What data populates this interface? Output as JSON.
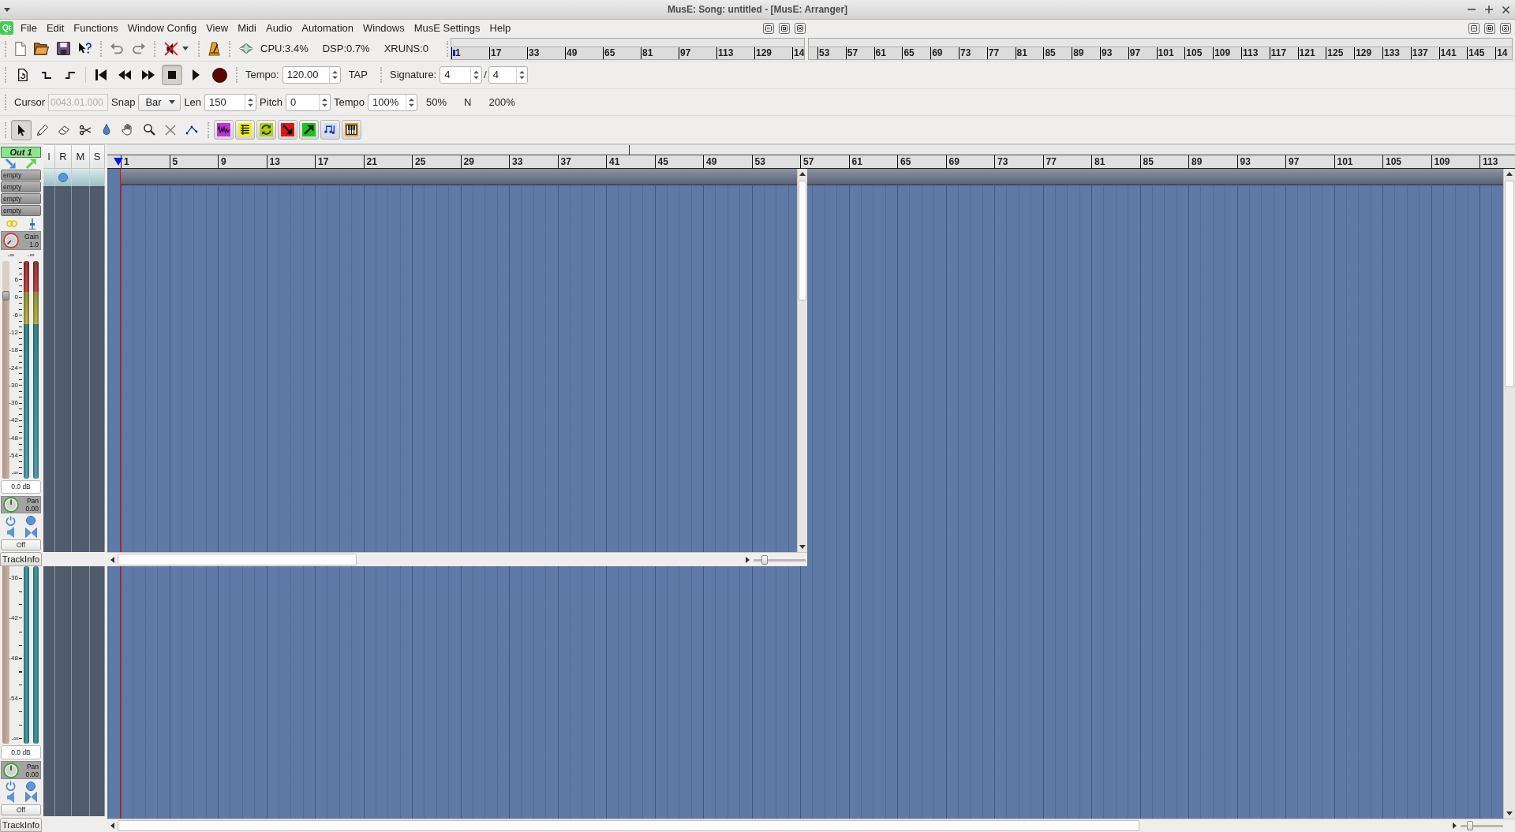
{
  "window": {
    "title": "MusE: Song: untitled - [MusE: Arranger]"
  },
  "app_logo": {
    "label": "Qt"
  },
  "menu": [
    {
      "label": "File"
    },
    {
      "label": "Edit"
    },
    {
      "label": "Functions"
    },
    {
      "label": "Window Config"
    },
    {
      "label": "View"
    },
    {
      "label": "Midi"
    },
    {
      "label": "Audio"
    },
    {
      "label": "Automation"
    },
    {
      "label": "Windows"
    },
    {
      "label": "MusE Settings"
    },
    {
      "label": "Help"
    }
  ],
  "status": {
    "cpu": "CPU:3.4%",
    "dsp": "DSP:0.7%",
    "xruns": "XRUNS:0"
  },
  "overview": {
    "left_labels": [
      "1",
      "17",
      "33",
      "49",
      "65",
      "81",
      "97",
      "113",
      "129",
      "14"
    ],
    "right_labels": [
      "53",
      "57",
      "61",
      "65",
      "69",
      "73",
      "77",
      "81",
      "85",
      "89",
      "93",
      "97",
      "101",
      "105",
      "109",
      "113",
      "117",
      "121",
      "125",
      "129",
      "133",
      "137",
      "141",
      "145",
      "14"
    ]
  },
  "transport": {
    "buttons": [
      {
        "kind": "page",
        "on": false
      },
      {
        "kind": "punchin",
        "on": false
      },
      {
        "kind": "punchout",
        "on": false
      },
      {
        "kind": "start",
        "on": false
      },
      {
        "kind": "rewind",
        "on": false
      },
      {
        "kind": "forward",
        "on": false
      },
      {
        "kind": "stop",
        "on": true
      },
      {
        "kind": "play",
        "on": false
      },
      {
        "kind": "record",
        "on": false
      }
    ],
    "tempo_label": "Tempo:",
    "tempo": "120.00",
    "tap": "TAP",
    "signature_label": "Signature:",
    "signature_numerator": "4",
    "signature_separator": "/",
    "signature_denominator": "4"
  },
  "edit_bar": {
    "cursor_label": "Cursor",
    "cursor": {
      "value": "0043.01.000",
      "disabled": true
    },
    "snap_label": "Snap",
    "snap": "Bar",
    "len_label": "Len",
    "len": "150",
    "pitch_label": "Pitch",
    "pitch": "0",
    "tempo_label": "Tempo",
    "tempo": "100%",
    "zoom_presets": [
      "50%",
      "N",
      "200%"
    ]
  },
  "tools": [
    {
      "kind": "pointer",
      "selected": true
    },
    {
      "kind": "pencil",
      "selected": false
    },
    {
      "kind": "eraser",
      "selected": false
    },
    {
      "kind": "scissors",
      "selected": false
    },
    {
      "kind": "glue",
      "selected": false
    },
    {
      "kind": "hand",
      "selected": false
    },
    {
      "kind": "zoom",
      "selected": false
    },
    {
      "kind": "cross",
      "selected": false
    },
    {
      "kind": "line",
      "selected": false
    }
  ],
  "editors": [
    {
      "kind": "wave"
    },
    {
      "kind": "list"
    },
    {
      "kind": "refresh"
    },
    {
      "kind": "down"
    },
    {
      "kind": "up"
    },
    {
      "kind": "notes"
    },
    {
      "kind": "piano"
    }
  ],
  "track_info": {
    "name": "Out 1",
    "effects": [
      "empty",
      "empty",
      "empty",
      "empty"
    ],
    "gain_label": "Gain",
    "gain": "1.0",
    "peaks": [
      "-∞",
      "-∞"
    ],
    "scale": [
      "6",
      "0",
      "-6",
      "-12",
      "-18",
      "-24",
      "-30",
      "-36",
      "-42",
      "-48",
      "-54",
      "-∞"
    ],
    "fader": {
      "level": 0.84
    },
    "volume": "0.0 dB",
    "pan_label": "Pan",
    "pan": "0.00",
    "automation": "Off",
    "tab": "TrackInfo"
  },
  "track_list": {
    "columns": [
      "I",
      "R",
      "M",
      "S"
    ]
  },
  "ruler": {
    "labels": [
      "1",
      "5",
      "9",
      "13",
      "17",
      "21",
      "25",
      "29",
      "33",
      "37",
      "41",
      "45",
      "49",
      "53",
      "57",
      "61",
      "65",
      "69",
      "73",
      "77",
      "81",
      "85",
      "89",
      "93",
      "97",
      "101",
      "105",
      "109",
      "113"
    ]
  },
  "zoom_slider": {
    "level": 0.18
  },
  "track_info_lower": {
    "scale": [
      "-36",
      "-42",
      "-48",
      "-54",
      "-∞"
    ],
    "volume": "0.0 dB",
    "pan_label": "Pan",
    "pan": "0.00",
    "automation": "Off",
    "tab": "TrackInfo"
  },
  "zoom_slider_lower": {
    "level": 0.18
  }
}
